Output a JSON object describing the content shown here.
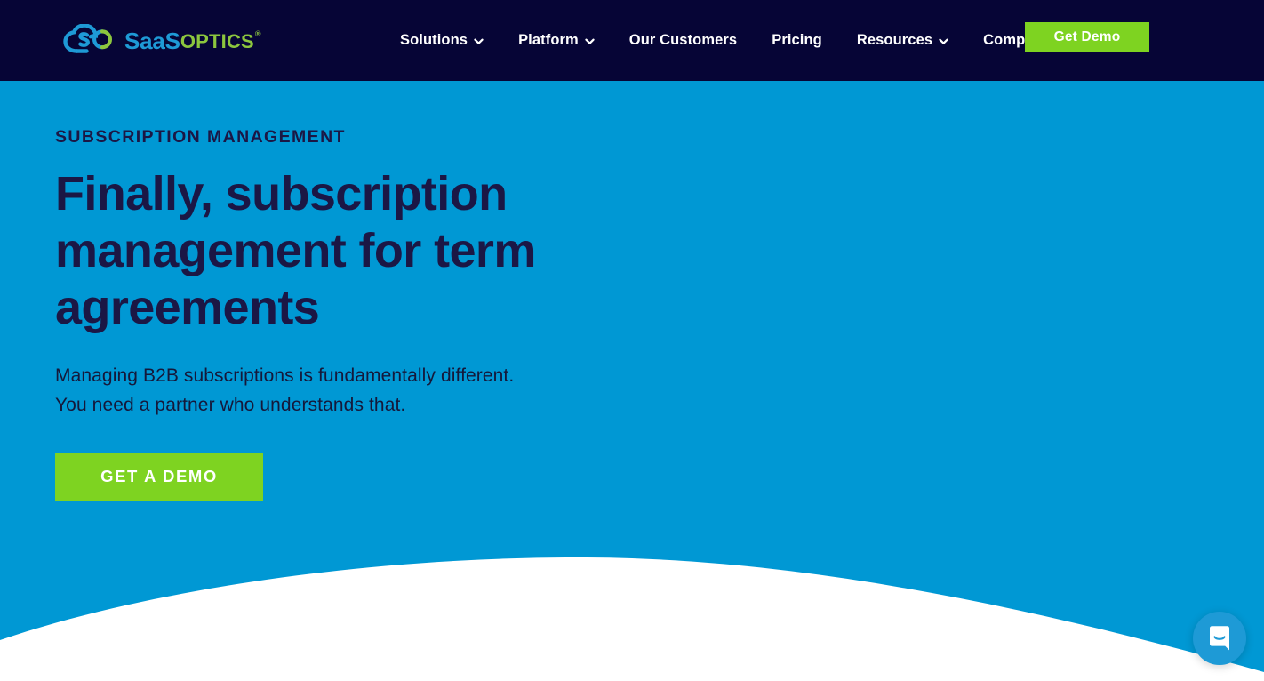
{
  "header": {
    "logo": {
      "icon_name": "saasoptics-cloud-logo",
      "text_primary": "SaaS",
      "text_secondary": "OPTICS",
      "trademark": "®",
      "color_primary": "#1e9ad6",
      "color_secondary": "#8cc63e"
    },
    "background_color": "#060536",
    "nav": [
      {
        "label": "Solutions",
        "has_dropdown": true,
        "icon": "chevron-down-icon"
      },
      {
        "label": "Platform",
        "has_dropdown": true,
        "icon": "chevron-down-icon"
      },
      {
        "label": "Our Customers",
        "has_dropdown": false,
        "icon": ""
      },
      {
        "label": "Pricing",
        "has_dropdown": false,
        "icon": ""
      },
      {
        "label": "Resources",
        "has_dropdown": true,
        "icon": "chevron-down-icon"
      },
      {
        "label": "Company",
        "has_dropdown": true,
        "icon": "chevron-down-icon"
      }
    ],
    "cta": {
      "label": "Get Demo",
      "background_color": "#7ed321",
      "text_color": "#ffffff"
    }
  },
  "hero": {
    "background_color": "#0098d4",
    "text_color": "#1b1745",
    "eyebrow": "SUBSCRIPTION MANAGEMENT",
    "title": "Finally, subscription management for term agreements",
    "subtitle": "Managing B2B subscriptions is fundamentally different. You need a partner who understands that.",
    "cta": {
      "label": "GET A DEMO",
      "background_color": "#7ed321",
      "text_color": "#ffffff"
    },
    "wave_color": "#ffffff"
  },
  "chat_widget": {
    "icon_name": "chat-bubble-smile-icon",
    "background_color": "#1e9ad6",
    "bubble_color": "#ffffff"
  }
}
